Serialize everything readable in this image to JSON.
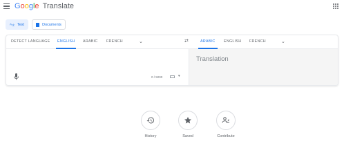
{
  "header": {
    "logo_letters": [
      "G",
      "o",
      "o",
      "g",
      "l",
      "e"
    ],
    "product": "Translate"
  },
  "modes": {
    "text": "Text",
    "documents": "Documents"
  },
  "source_langs": [
    "DETECT LANGUAGE",
    "ENGLISH",
    "ARABIC",
    "FRENCH"
  ],
  "target_langs": [
    "ARABIC",
    "ENGLISH",
    "FRENCH"
  ],
  "source": {
    "counter": "0 / 5000"
  },
  "target": {
    "placeholder": "Translation"
  },
  "shortcuts": {
    "history": "History",
    "saved": "Saved",
    "contribute": "Contribute"
  },
  "colors": {
    "accent": "#1a73e8",
    "accent_bg": "#e8f0fe",
    "target_bg": "#f5f5f5"
  }
}
